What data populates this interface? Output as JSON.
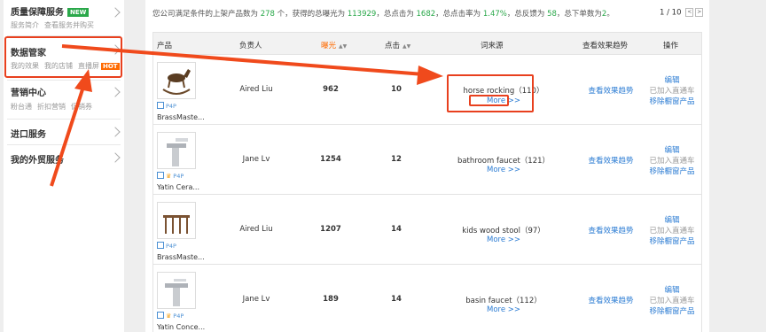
{
  "sidebar": {
    "sections": [
      {
        "title": "质量保障服务",
        "badge": "NEW",
        "subs": [
          "服务简介",
          "查看服务并购买"
        ]
      },
      {
        "title": "数据管家",
        "subs": [
          "我的效果",
          "我的店铺",
          "直播屏"
        ],
        "badge": "HOT"
      },
      {
        "title": "营销中心",
        "subs": [
          "粉台通",
          "折扣营销",
          "促销券"
        ]
      },
      {
        "title": "进口服务"
      },
      {
        "title": "我的外贸服务"
      }
    ]
  },
  "summary": {
    "p1": "您公司满足条件的上架产品数为 ",
    "count": "278",
    "p2": " 个，获得的总曝光为 ",
    "exposure": "113929",
    "p3": "，总点击为 ",
    "clicks": "1682",
    "p4": "，总点击率为 ",
    "ctr": "1.47%",
    "p5": "，总反馈为 ",
    "feedback": "58",
    "p6": "，总下单数为",
    "orders": "2",
    "p7": "。"
  },
  "pager": {
    "text": "1 / 10",
    "prev": "<",
    "next": ">"
  },
  "table": {
    "headers": {
      "product": "产品",
      "owner": "负责人",
      "exposure": "曝光",
      "clicks": "点击",
      "keyword": "词来源",
      "trend": "查看效果趋势",
      "action": "操作"
    },
    "p4p_label": "P4P",
    "more_label": "More >>",
    "trend_label": "查看效果趋势",
    "edit_label": "编辑",
    "added_label": "已加入直通车",
    "remove_label": "移除橱窗产品",
    "rows": [
      {
        "product": "BrassMaste...",
        "owner": "Aired Liu",
        "exposure": "962",
        "clicks": "10",
        "keyword": "horse rocking（110）",
        "crown": false
      },
      {
        "product": "Yatin Cera...",
        "owner": "Jane Lv",
        "exposure": "1254",
        "clicks": "12",
        "keyword": "bathroom faucet（121）",
        "crown": true
      },
      {
        "product": "BrassMaste...",
        "owner": "Aired Liu",
        "exposure": "1207",
        "clicks": "14",
        "keyword": "kids wood stool（97）",
        "crown": false
      },
      {
        "product": "Yatin Conce...",
        "owner": "Jane Lv",
        "exposure": "189",
        "clicks": "14",
        "keyword": "basin faucet（112）",
        "crown": true
      }
    ]
  }
}
